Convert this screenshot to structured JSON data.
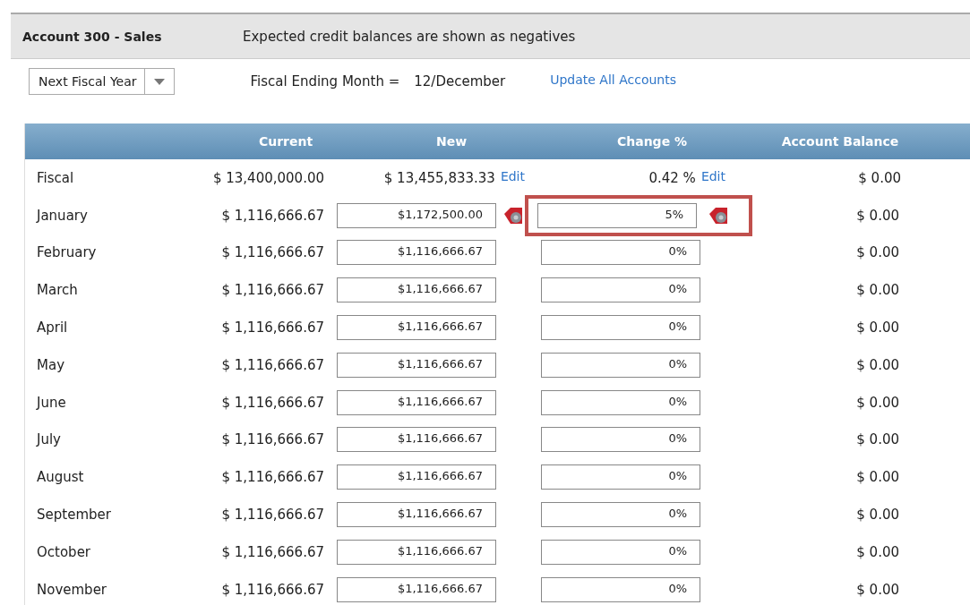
{
  "header": {
    "title": "Account 300 - Sales",
    "note": "Expected credit balances are shown as negatives"
  },
  "toolbar": {
    "period_dropdown": "Next Fiscal Year",
    "fiscal_label": "Fiscal Ending Month =",
    "fiscal_value": "12/December",
    "update_link": "Update All Accounts"
  },
  "table": {
    "columns": [
      "Current",
      "New",
      "Change %",
      "Account Balance"
    ],
    "rows": [
      {
        "kind": "total",
        "month": "Fiscal",
        "current": "$ 13,400,000.00",
        "new": "$ 13,455,833.33",
        "new_edit": "Edit",
        "change": "0.42 %",
        "change_edit": "Edit",
        "balance": "$ 0.00"
      },
      {
        "kind": "input",
        "month": "January",
        "current": "$ 1,116,666.67",
        "new": "$1,172,500.00",
        "change": "5%",
        "balance": "$ 0.00",
        "modified": true,
        "highlighted": true
      },
      {
        "kind": "input",
        "month": "February",
        "current": "$ 1,116,666.67",
        "new": "$1,116,666.67",
        "change": "0%",
        "balance": "$ 0.00",
        "modified": false,
        "highlighted": false
      },
      {
        "kind": "input",
        "month": "March",
        "current": "$ 1,116,666.67",
        "new": "$1,116,666.67",
        "change": "0%",
        "balance": "$ 0.00",
        "modified": false,
        "highlighted": false
      },
      {
        "kind": "input",
        "month": "April",
        "current": "$ 1,116,666.67",
        "new": "$1,116,666.67",
        "change": "0%",
        "balance": "$ 0.00",
        "modified": false,
        "highlighted": false
      },
      {
        "kind": "input",
        "month": "May",
        "current": "$ 1,116,666.67",
        "new": "$1,116,666.67",
        "change": "0%",
        "balance": "$ 0.00",
        "modified": false,
        "highlighted": false
      },
      {
        "kind": "input",
        "month": "June",
        "current": "$ 1,116,666.67",
        "new": "$1,116,666.67",
        "change": "0%",
        "balance": "$ 0.00",
        "modified": false,
        "highlighted": false
      },
      {
        "kind": "input",
        "month": "July",
        "current": "$ 1,116,666.67",
        "new": "$1,116,666.67",
        "change": "0%",
        "balance": "$ 0.00",
        "modified": false,
        "highlighted": false
      },
      {
        "kind": "input",
        "month": "August",
        "current": "$ 1,116,666.67",
        "new": "$1,116,666.67",
        "change": "0%",
        "balance": "$ 0.00",
        "modified": false,
        "highlighted": false
      },
      {
        "kind": "input",
        "month": "September",
        "current": "$ 1,116,666.67",
        "new": "$1,116,666.67",
        "change": "0%",
        "balance": "$ 0.00",
        "modified": false,
        "highlighted": false
      },
      {
        "kind": "input",
        "month": "October",
        "current": "$ 1,116,666.67",
        "new": "$1,116,666.67",
        "change": "0%",
        "balance": "$ 0.00",
        "modified": false,
        "highlighted": false
      },
      {
        "kind": "input",
        "month": "November",
        "current": "$ 1,116,666.67",
        "new": "$1,116,666.67",
        "change": "0%",
        "balance": "$ 0.00",
        "modified": false,
        "highlighted": false
      }
    ]
  }
}
